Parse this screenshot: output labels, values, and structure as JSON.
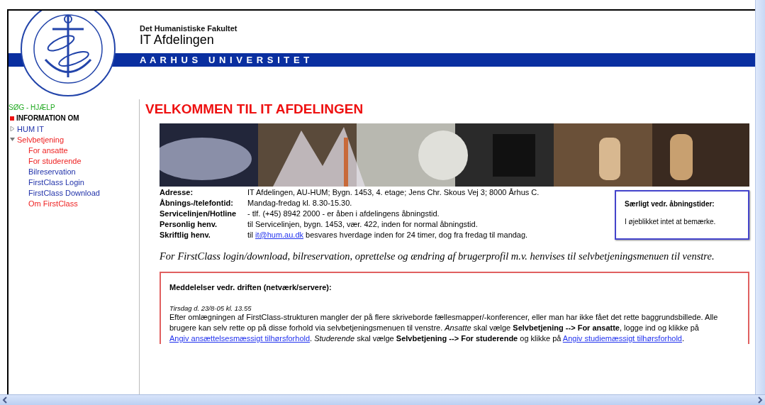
{
  "header": {
    "faculty": "Det Humanistiske Fakultet",
    "department": "IT Afdelingen",
    "university": "A A R H U S   U N I V E R S I T E T"
  },
  "sidebar": {
    "items": [
      {
        "kind": "search",
        "label": "SØG - HJÆLP",
        "color": "#22aa22"
      },
      {
        "kind": "section",
        "label": "INFORMATION OM",
        "color": "#000000"
      },
      {
        "kind": "node",
        "label": "HUM IT",
        "color": "#2233aa",
        "expanded": false
      },
      {
        "kind": "node",
        "label": "Selvbetjening",
        "color": "#ee2222",
        "expanded": true,
        "children": [
          {
            "label": "For ansatte",
            "color": "#ee2222"
          },
          {
            "label": "For studerende",
            "color": "#ee2222"
          },
          {
            "label": "Bilreservation",
            "color": "#2233aa"
          },
          {
            "label": "FirstClass Login",
            "color": "#2233aa"
          },
          {
            "label": "FirstClass Download",
            "color": "#2233aa"
          },
          {
            "label": "Om FirstClass",
            "color": "#ee2222"
          }
        ]
      }
    ]
  },
  "main": {
    "heading": "VELKOMMEN TIL IT AFDELINGEN",
    "contact_rows": [
      {
        "label": "Adresse:",
        "value": [
          {
            "kind": "text",
            "text": "IT Afdelingen, AU-HUM; Bygn. 1453, 4. etage; Jens Chr. Skous Vej 3; 8000 Århus C."
          }
        ]
      },
      {
        "label": "Åbnings-/telefontid:",
        "value": [
          {
            "kind": "text",
            "text": "Mandag-fredag kl. 8.30-15.30."
          }
        ]
      },
      {
        "label": "Servicelinjen/Hotline",
        "value": [
          {
            "kind": "text",
            "text": "- tlf. (+45) 8942 2000 - er åben i afdelingens åbningstid."
          }
        ]
      },
      {
        "label": "Personlig henv.",
        "value": [
          {
            "kind": "text",
            "text": "til Servicelinjen, bygn. 1453, vær. 422, inden for normal åbningstid."
          }
        ]
      },
      {
        "label": "Skriftlig henv.",
        "value": [
          {
            "kind": "text",
            "text": "til "
          },
          {
            "kind": "link",
            "text": "it@hum.au.dk"
          },
          {
            "kind": "text",
            "text": " besvares hverdage inden for 24 timer, dog fra fredag til mandag."
          }
        ]
      }
    ],
    "hours_box": {
      "title": "Særligt vedr. åbningstider:",
      "text": "I øjeblikket intet at bemærke."
    },
    "intro": "For FirstClass login/download, bilreservation, oprettelse og ændring af brugerprofil m.v. henvises til selvbetjeningsmenuen til venstre.",
    "notice": {
      "title": "Meddelelser vedr. driften (netværk/servere):",
      "date": "Tirsdag d. 23/8-05 kl. 13.55",
      "body": [
        {
          "kind": "text",
          "text": "Efter omlægningen af FirstClass-strukturen mangler der på flere skriveborde fællesmapper/-konferencer, eller man har ikke fået det rette baggrundsbillede. Alle brugere kan selv rette op på disse forhold via selvbetjeningsmenuen til venstre. "
        },
        {
          "kind": "italic",
          "text": "Ansatte"
        },
        {
          "kind": "text",
          "text": " skal vælge "
        },
        {
          "kind": "bold",
          "text": "Selvbetjening --> For ansatte"
        },
        {
          "kind": "text",
          "text": ", logge ind og klikke på "
        },
        {
          "kind": "link",
          "text": "Angiv ansættelsesmæssigt tilhørsforhold"
        },
        {
          "kind": "text",
          "text": ". "
        },
        {
          "kind": "italic",
          "text": "Studerende"
        },
        {
          "kind": "text",
          "text": " skal vælge "
        },
        {
          "kind": "bold",
          "text": "Selvbetjening --> For studerende"
        },
        {
          "kind": "text",
          "text": " og klikke på "
        },
        {
          "kind": "link",
          "text": "Angiv studiemæssigt tilhørsforhold"
        },
        {
          "kind": "text",
          "text": "."
        }
      ]
    }
  }
}
